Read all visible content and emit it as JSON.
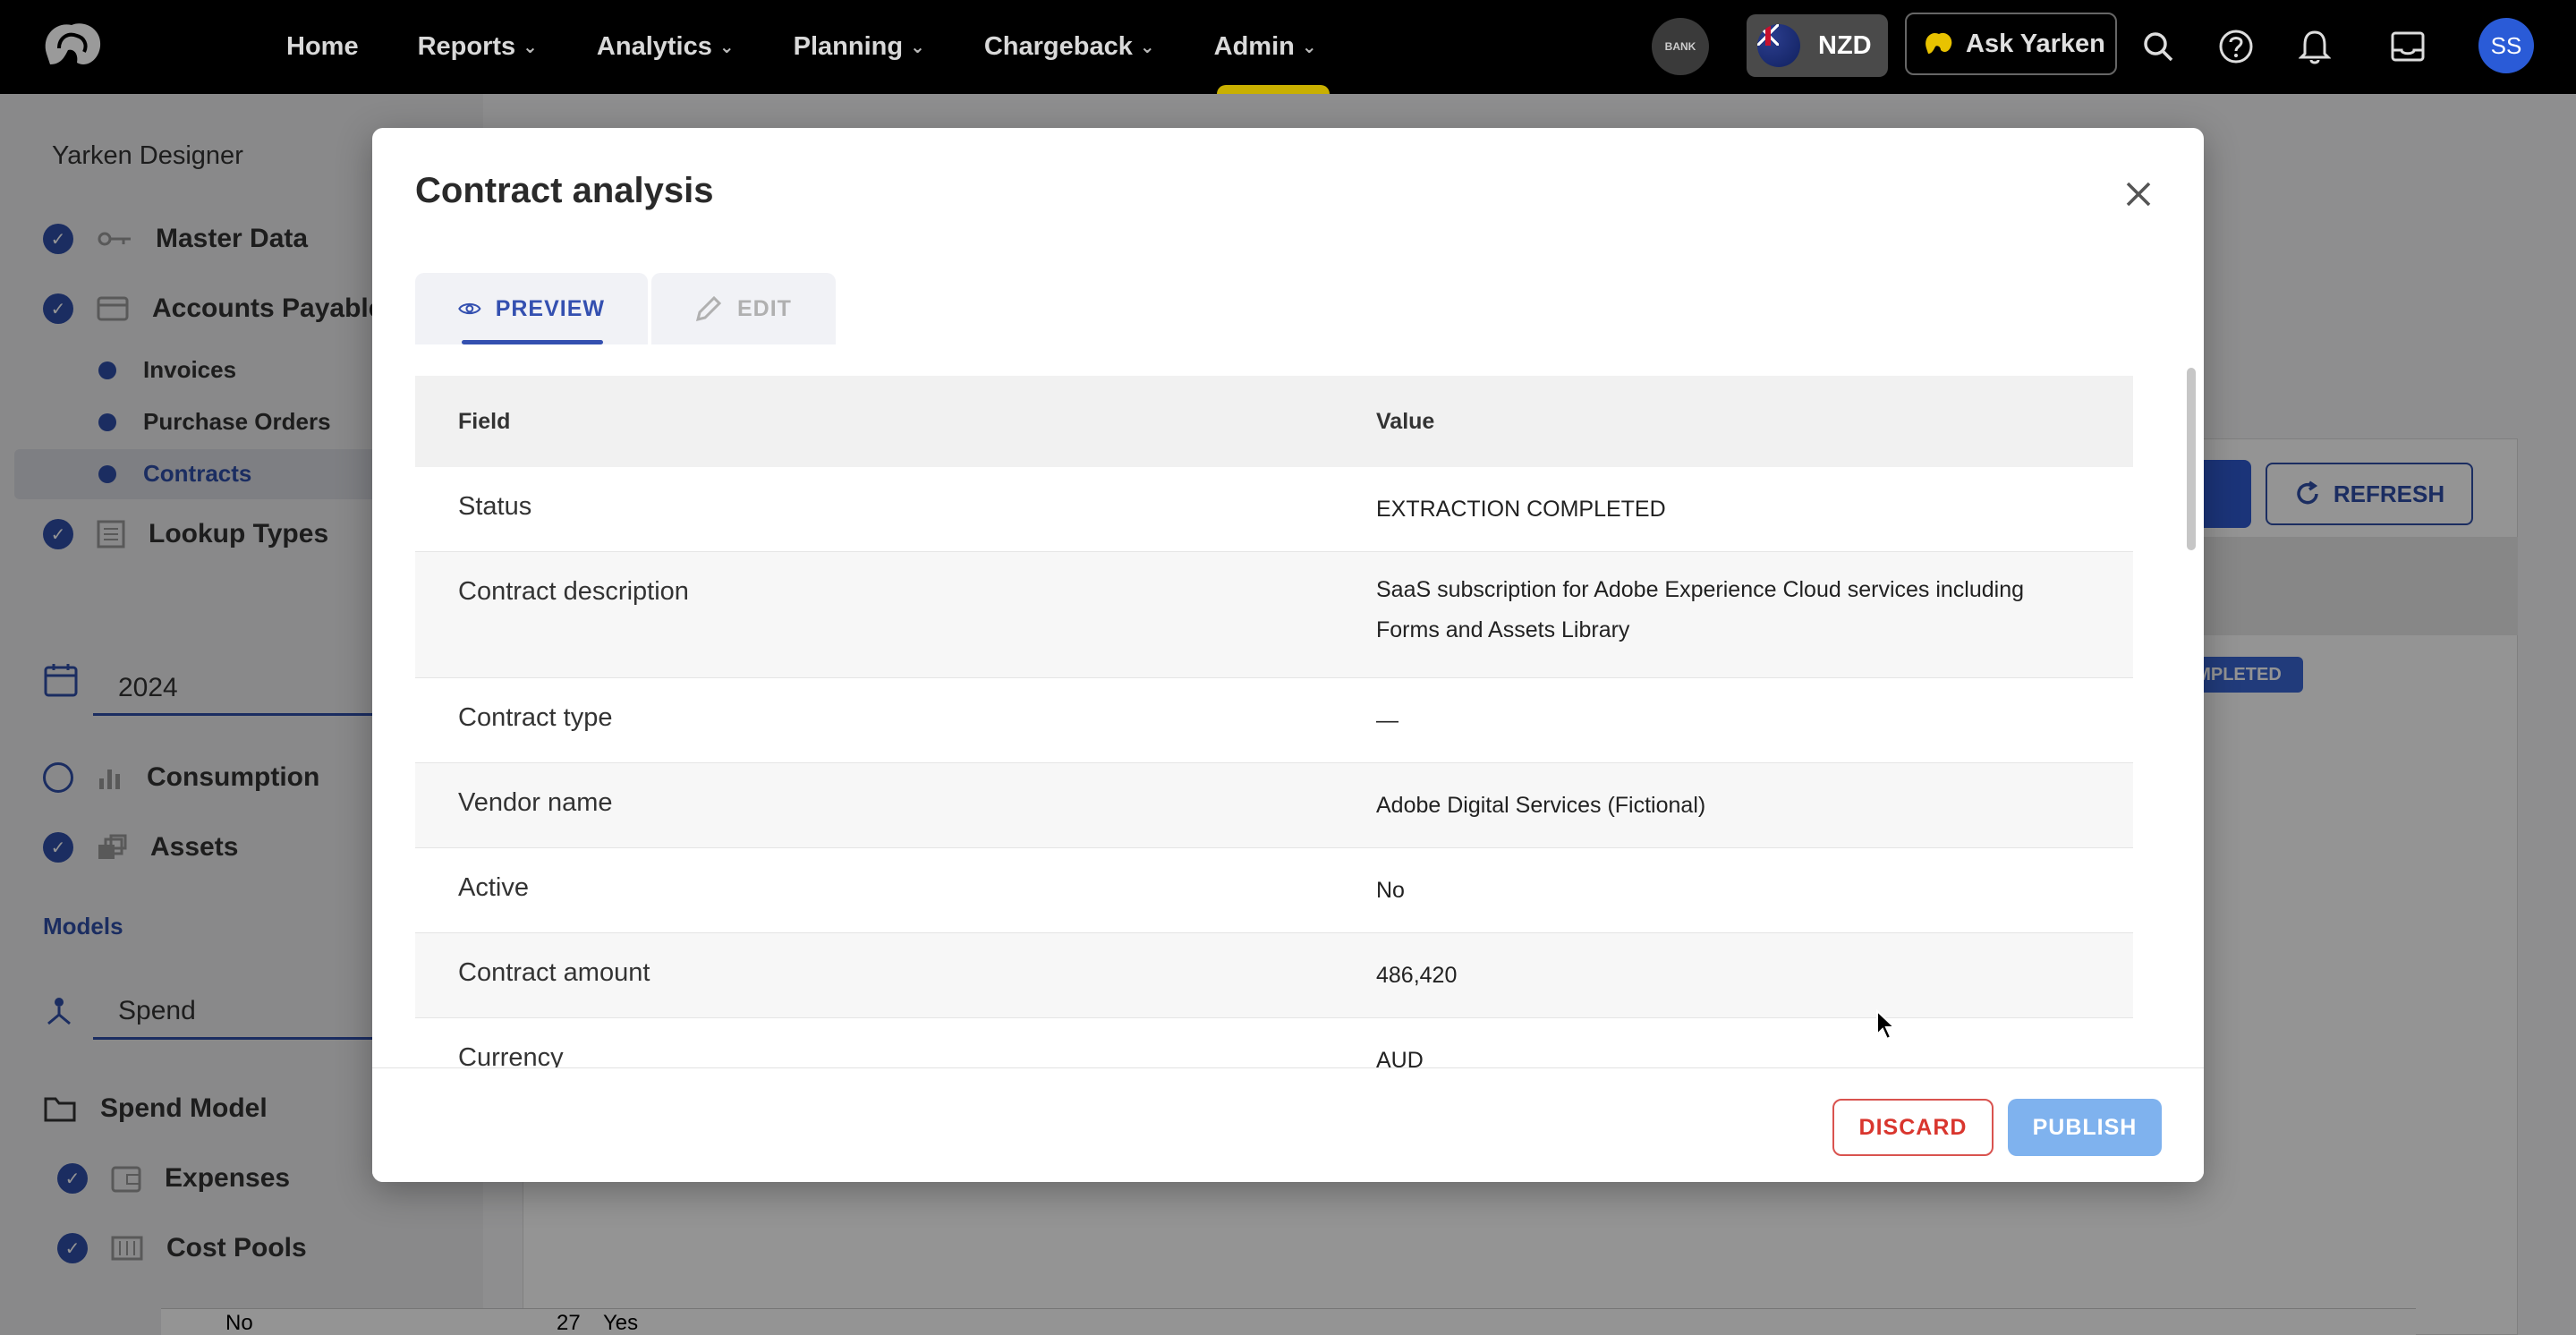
{
  "topnav": {
    "items": [
      {
        "label": "Home",
        "has_menu": false
      },
      {
        "label": "Reports",
        "has_menu": true
      },
      {
        "label": "Analytics",
        "has_menu": true
      },
      {
        "label": "Planning",
        "has_menu": true
      },
      {
        "label": "Chargeback",
        "has_menu": true
      },
      {
        "label": "Admin",
        "has_menu": true,
        "active": true
      }
    ],
    "bank_label": "BANK",
    "currency": "NZD",
    "ask_label": "Ask Yarken",
    "avatar_initials": "SS"
  },
  "sidebar": {
    "title": "Yarken Designer",
    "master_data": "Master Data",
    "accounts_payable": "Accounts Payable",
    "sub_items": [
      "Invoices",
      "Purchase Orders",
      "Contracts"
    ],
    "selected_sub_item": "Contracts",
    "lookup_types": "Lookup Types",
    "year": "2024",
    "consumption": "Consumption",
    "assets": "Assets",
    "models_label": "Models",
    "spend": "Spend",
    "spend_model": "Spend Model",
    "expenses": "Expenses",
    "cost_pools": "Cost Pools"
  },
  "background": {
    "refresh_label": "REFRESH",
    "badge_text": "MPLETED",
    "bottom_row": {
      "c1": "No",
      "c2": "27",
      "c3": "Yes"
    }
  },
  "modal": {
    "title": "Contract analysis",
    "tabs": {
      "preview": "PREVIEW",
      "edit": "EDIT"
    },
    "active_tab": "PREVIEW",
    "table": {
      "headers": {
        "field": "Field",
        "value": "Value"
      },
      "rows": [
        {
          "field": "Status",
          "value": "EXTRACTION COMPLETED"
        },
        {
          "field": "Contract description",
          "value": "SaaS subscription for Adobe Experience Cloud services including Forms and Assets Library"
        },
        {
          "field": "Contract type",
          "value": "—"
        },
        {
          "field": "Vendor name",
          "value": "Adobe Digital Services (Fictional)"
        },
        {
          "field": "Active",
          "value": "No"
        },
        {
          "field": "Contract amount",
          "value": "486,420"
        },
        {
          "field": "Currency",
          "value": "AUD"
        }
      ]
    },
    "discard_label": "DISCARD",
    "publish_label": "PUBLISH"
  },
  "colors": {
    "accent": "#3450b0",
    "topbar": "#000000",
    "discard": "#d9362e",
    "publish": "#7fb2ee",
    "admin_indicator": "#c9b000"
  },
  "icons": {
    "logo": "yarken-logo-icon",
    "search": "search-icon",
    "help": "help-icon",
    "notifications": "bell-icon",
    "inbox": "inbox-icon",
    "close": "close-icon",
    "preview": "eye-icon",
    "edit": "pencil-icon",
    "refresh": "refresh-icon"
  }
}
